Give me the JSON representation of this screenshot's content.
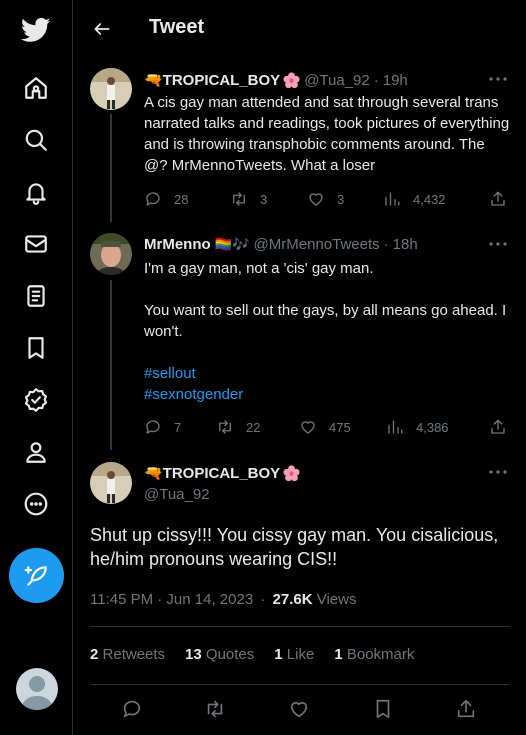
{
  "header": {
    "title": "Tweet"
  },
  "nav": {
    "items": [
      "twitter-logo",
      "home",
      "explore",
      "notifications",
      "messages",
      "lists",
      "bookmarks",
      "verified",
      "profile",
      "more"
    ],
    "compose_icon": "feather-plus-icon"
  },
  "tweets": [
    {
      "display_name": "🔫TROPICAL_BOY",
      "name_emoji": "hibiscus",
      "handle": "@Tua_92",
      "separator": "·",
      "time": "19h",
      "text": "A cis gay man attended and sat through several trans narrated talks and readings, took pictures of everything and is throwing transphobic comments around. The @? MrMennoTweets. What a loser",
      "replies": "28",
      "retweets": "3",
      "likes": "3",
      "views": "4,432"
    },
    {
      "display_name": "MrMenno",
      "name_emoji": "🏳️‍🌈🎶",
      "handle": "@MrMennoTweets",
      "separator": "·",
      "time": "18h",
      "text_line1": "I'm a gay man, not a 'cis' gay man.",
      "text_line2": "You want to sell out the gays, by all means go ahead. I won't.",
      "hashtag1": "#sellout",
      "hashtag2": "#sexnotgender",
      "replies": "7",
      "retweets": "22",
      "likes": "475",
      "views": "4,386"
    }
  ],
  "focused": {
    "display_name": "🔫TROPICAL_BOY",
    "name_emoji": "hibiscus",
    "handle": "@Tua_92",
    "text": "Shut up cissy!!! You cissy gay man. You cisalicious, he/him pronouns wearing CIS!!",
    "time": "11:45 PM · Jun 14, 2023",
    "dot": "·",
    "views_count": "27.6K",
    "views_label": "Views",
    "retweets_count": "2",
    "retweets_label": "Retweets",
    "quotes_count": "13",
    "quotes_label": "Quotes",
    "likes_count": "1",
    "likes_label": "Like",
    "bookmarks_count": "1",
    "bookmarks_label": "Bookmark"
  },
  "colors": {
    "accent": "#1d9bf0",
    "background": "#000000",
    "muted": "#71767b",
    "text": "#e7e9ea",
    "divider": "#2f3336"
  }
}
